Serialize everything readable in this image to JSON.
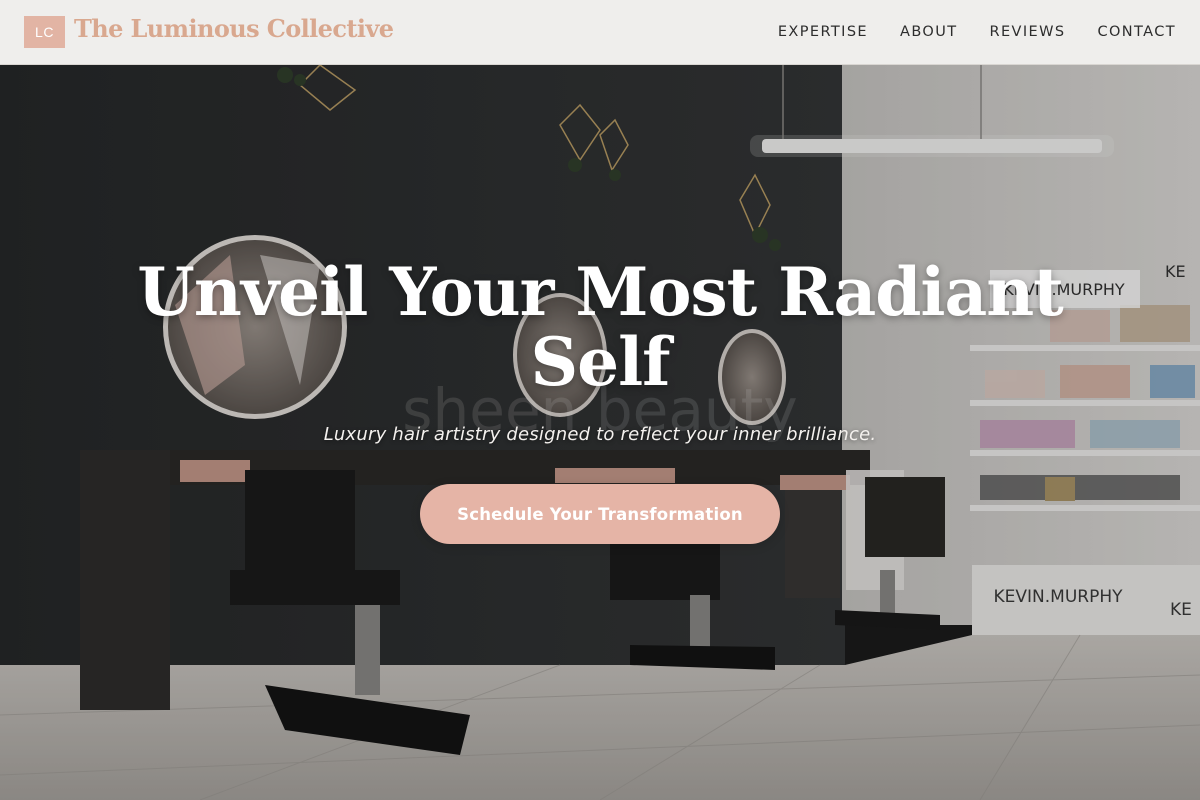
{
  "brand": {
    "initials": "LC",
    "name": "The Luminous Collective",
    "accent_color": "#e2b4a4"
  },
  "nav": {
    "items": [
      {
        "label": "EXPERTISE"
      },
      {
        "label": "ABOUT"
      },
      {
        "label": "REVIEWS"
      },
      {
        "label": "CONTACT"
      }
    ]
  },
  "hero": {
    "title_line1": "Unveil Your Most Radiant",
    "title_line2": "Self",
    "subtitle": "Luxury hair artistry designed to reflect your inner brilliance.",
    "cta_label": "Schedule Your Transformation",
    "cta_color": "#e5b4a6"
  },
  "photo": {
    "wall_sign": "sheen beauty",
    "shelf_brand_1": "KEVIN.MURPHY",
    "shelf_brand_2": "KEVIN.MURPHY",
    "shelf_brand_3": "KE",
    "shelf_brand_4": "KE"
  }
}
